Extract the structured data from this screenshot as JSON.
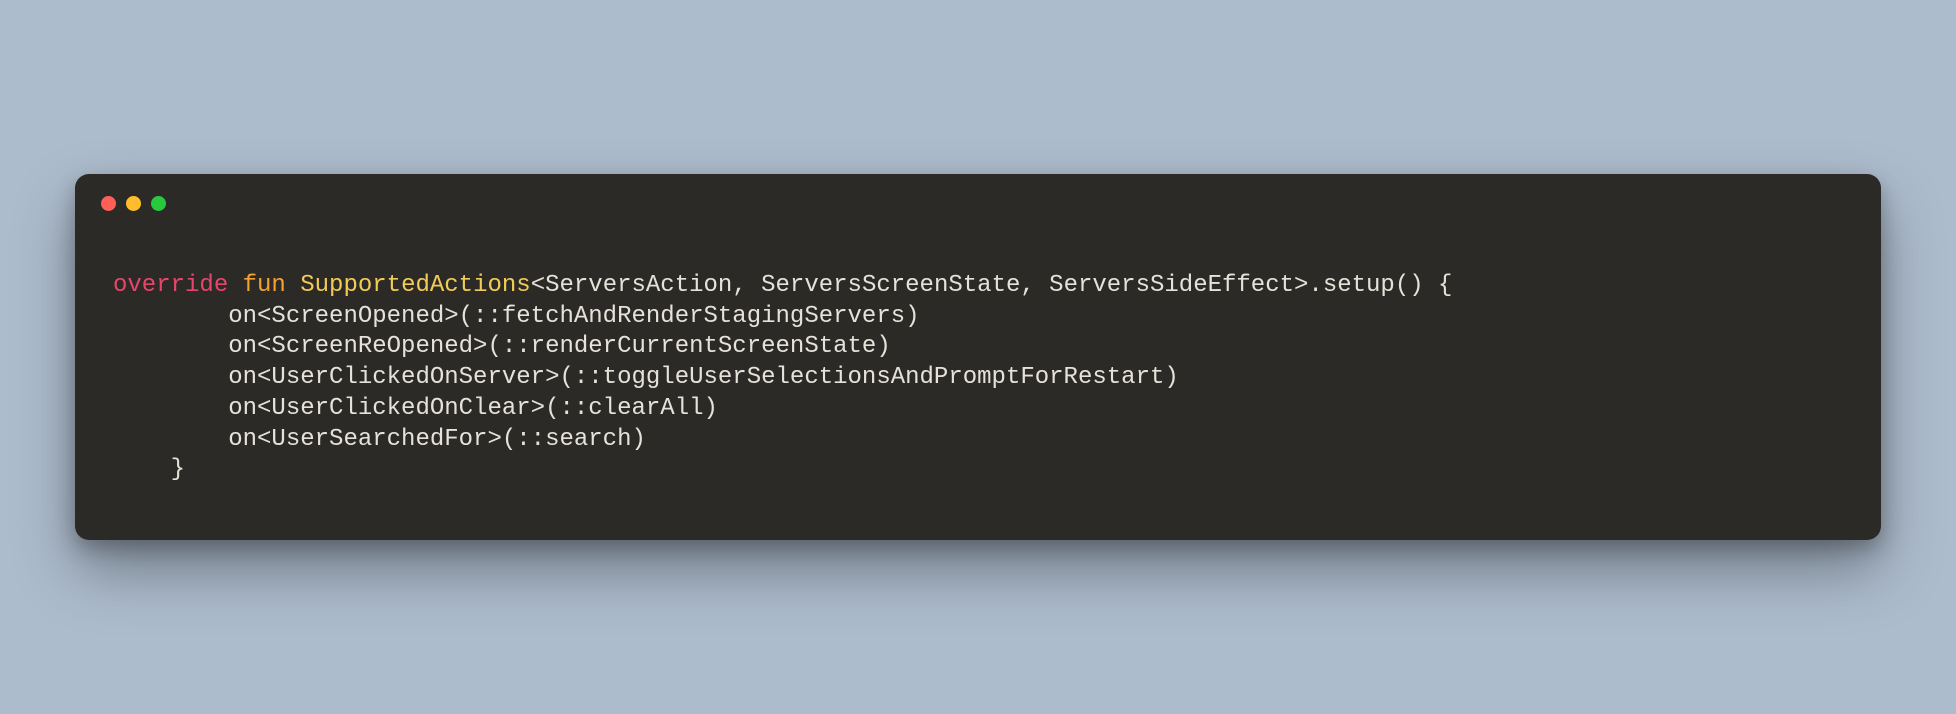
{
  "window": {
    "controls": {
      "close": "close",
      "minimize": "minimize",
      "zoom": "zoom"
    }
  },
  "code": {
    "l1": {
      "override": "override",
      "fun": "fun",
      "name": "SupportedActions",
      "rest": "<ServersAction, ServersScreenState, ServersSideEffect>.setup() {"
    },
    "l2": "        on<ScreenOpened>(::fetchAndRenderStagingServers)",
    "l3": "        on<ScreenReOpened>(::renderCurrentScreenState)",
    "l4": "        on<UserClickedOnServer>(::toggleUserSelectionsAndPromptForRestart)",
    "l5": "        on<UserClickedOnClear>(::clearAll)",
    "l6": "        on<UserSearchedFor>(::search)",
    "l7": "    }"
  }
}
